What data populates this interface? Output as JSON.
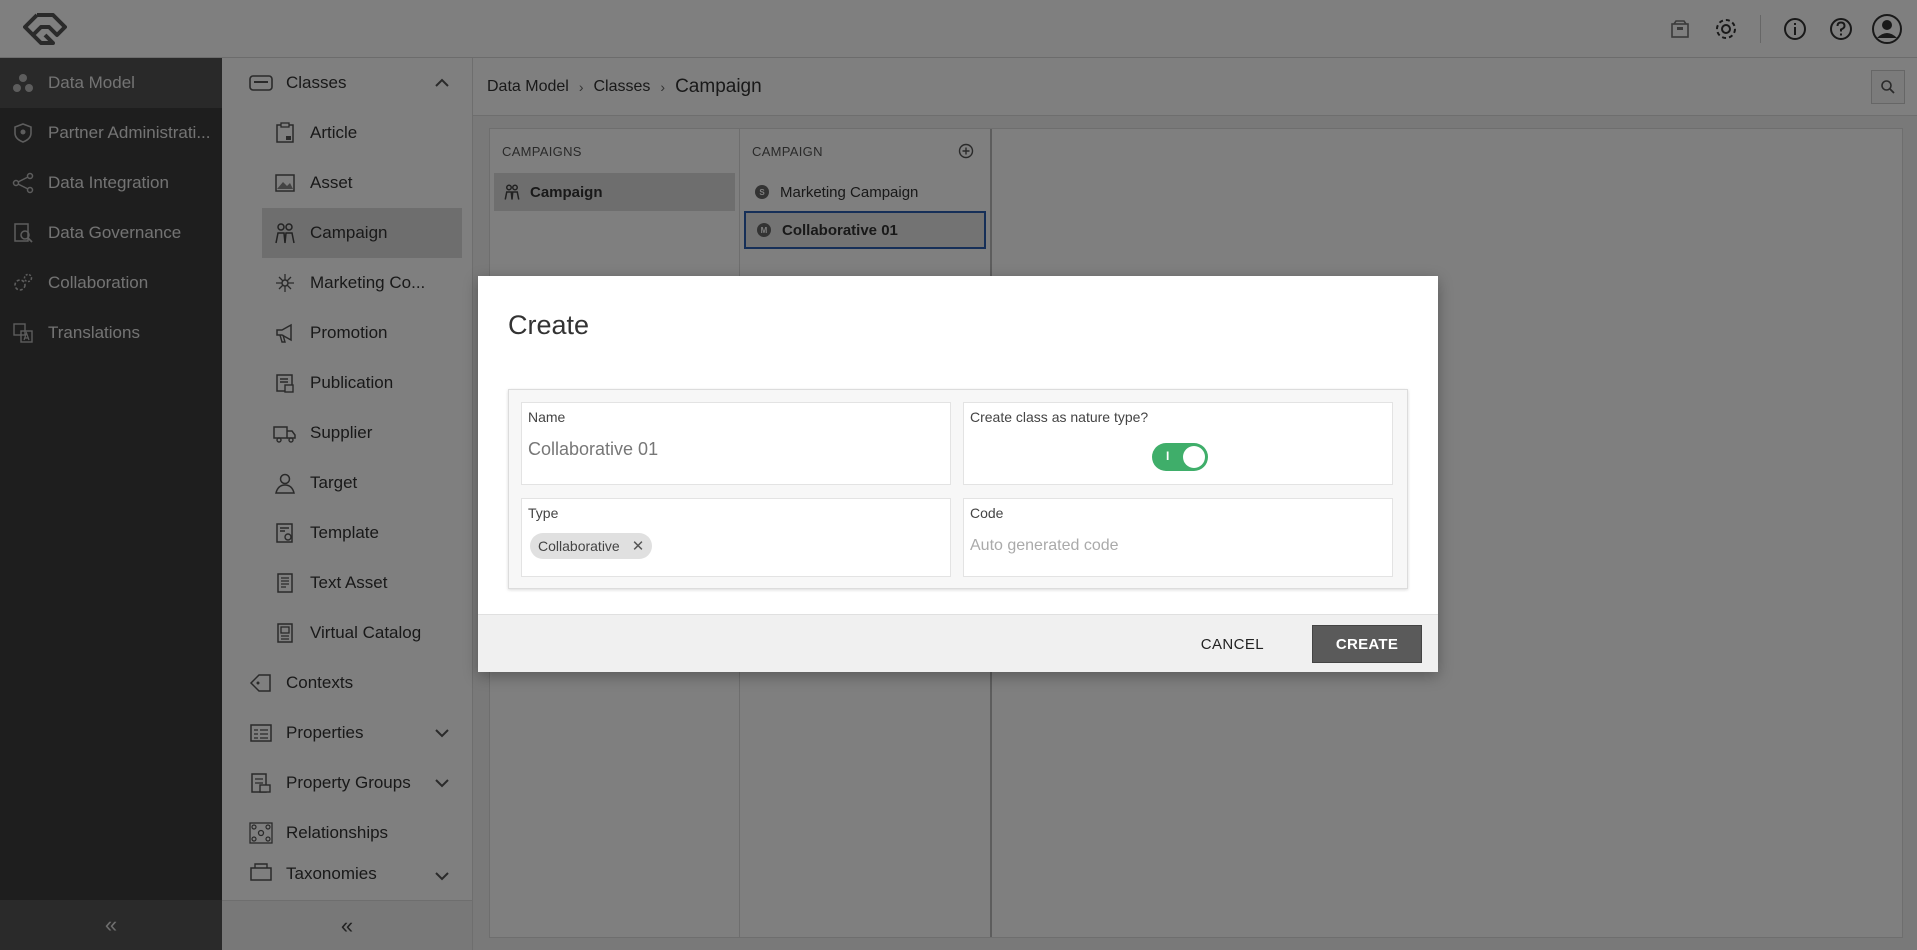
{
  "leftnav": {
    "items": [
      {
        "label": "Data Model",
        "icon": "data-model-icon",
        "active": true
      },
      {
        "label": "Partner Administrati...",
        "icon": "shield-icon"
      },
      {
        "label": "Data Integration",
        "icon": "share-icon"
      },
      {
        "label": "Data Governance",
        "icon": "governance-icon"
      },
      {
        "label": "Collaboration",
        "icon": "gears-icon"
      },
      {
        "label": "Translations",
        "icon": "translate-icon"
      }
    ],
    "collapse_glyph": "«"
  },
  "subnav": {
    "classes_label": "Classes",
    "items": [
      {
        "label": "Article"
      },
      {
        "label": "Asset"
      },
      {
        "label": "Campaign"
      },
      {
        "label": "Marketing Co..."
      },
      {
        "label": "Promotion"
      },
      {
        "label": "Publication"
      },
      {
        "label": "Supplier"
      },
      {
        "label": "Target"
      },
      {
        "label": "Template"
      },
      {
        "label": "Text Asset"
      },
      {
        "label": "Virtual Catalog"
      }
    ],
    "contexts_label": "Contexts",
    "properties_label": "Properties",
    "property_groups_label": "Property Groups",
    "relationships_label": "Relationships",
    "taxonomies_label": "Taxonomies",
    "collapse_glyph": "«"
  },
  "breadcrumb": {
    "crumbs": [
      "Data Model",
      "Classes"
    ],
    "current": "Campaign",
    "separator": "›"
  },
  "panels": {
    "campaigns_header": "CAMPAIGNS",
    "campaigns_row": "Campaign",
    "campaign_header": "CAMPAIGN",
    "rows": [
      {
        "label": "Marketing Campaign",
        "badge": "S"
      },
      {
        "label": "Collaborative 01",
        "badge": "M"
      }
    ]
  },
  "dialog": {
    "title": "Create",
    "name_label": "Name",
    "name_value": "Collaborative 01",
    "nature_label": "Create class as nature type?",
    "nature_toggle_mark": "I",
    "nature_on": true,
    "type_label": "Type",
    "type_chip": "Collaborative",
    "code_label": "Code",
    "code_placeholder": "Auto generated code",
    "cancel_label": "CANCEL",
    "create_label": "CREATE"
  },
  "colors": {
    "toggle_on": "#3fae6a",
    "nav_bg": "#3d3d3d",
    "focus_border": "#2c5fb0"
  }
}
